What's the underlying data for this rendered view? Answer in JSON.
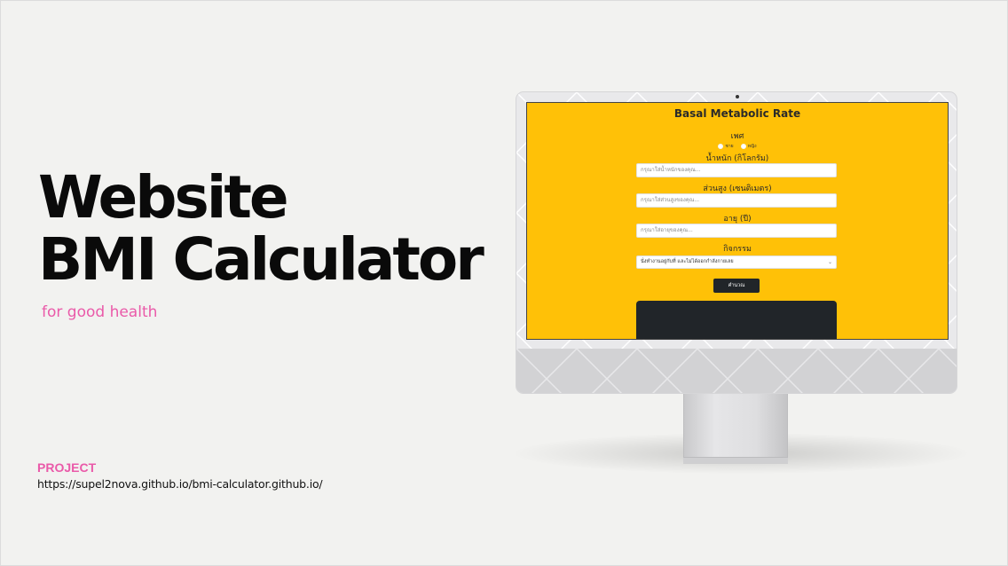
{
  "slide": {
    "title_line1": "Website",
    "title_line2": "BMI Calculator",
    "tagline": "for good health",
    "project_label": "PROJECT",
    "project_url": "https://supel2nova.github.io/bmi-calculator.github.io/"
  },
  "app": {
    "title": "Basal Metabolic Rate",
    "gender_label": "เพศ",
    "gender_options": [
      "ชาย",
      "หญิง"
    ],
    "weight_label": "น้ำหนัก (กิโลกรัม)",
    "weight_placeholder": "กรุณาใส่น้ำหนักของคุณ...",
    "height_label": "ส่วนสูง (เซนติเมตร)",
    "height_placeholder": "กรุณาใส่ส่วนสูงของคุณ...",
    "age_label": "อายุ (ปี)",
    "age_placeholder": "กรุณาใส่อายุของคุณ...",
    "activity_label": "กิจกรรม",
    "activity_selected": "นั่งทำงานอยู่กับที่ และไม่ได้ออกกำลังกายเลย",
    "calculate_label": "คำนวณ"
  },
  "colors": {
    "screen_bg": "#ffc107",
    "accent_pink": "#ea5aa9",
    "dark_button": "#212529"
  }
}
